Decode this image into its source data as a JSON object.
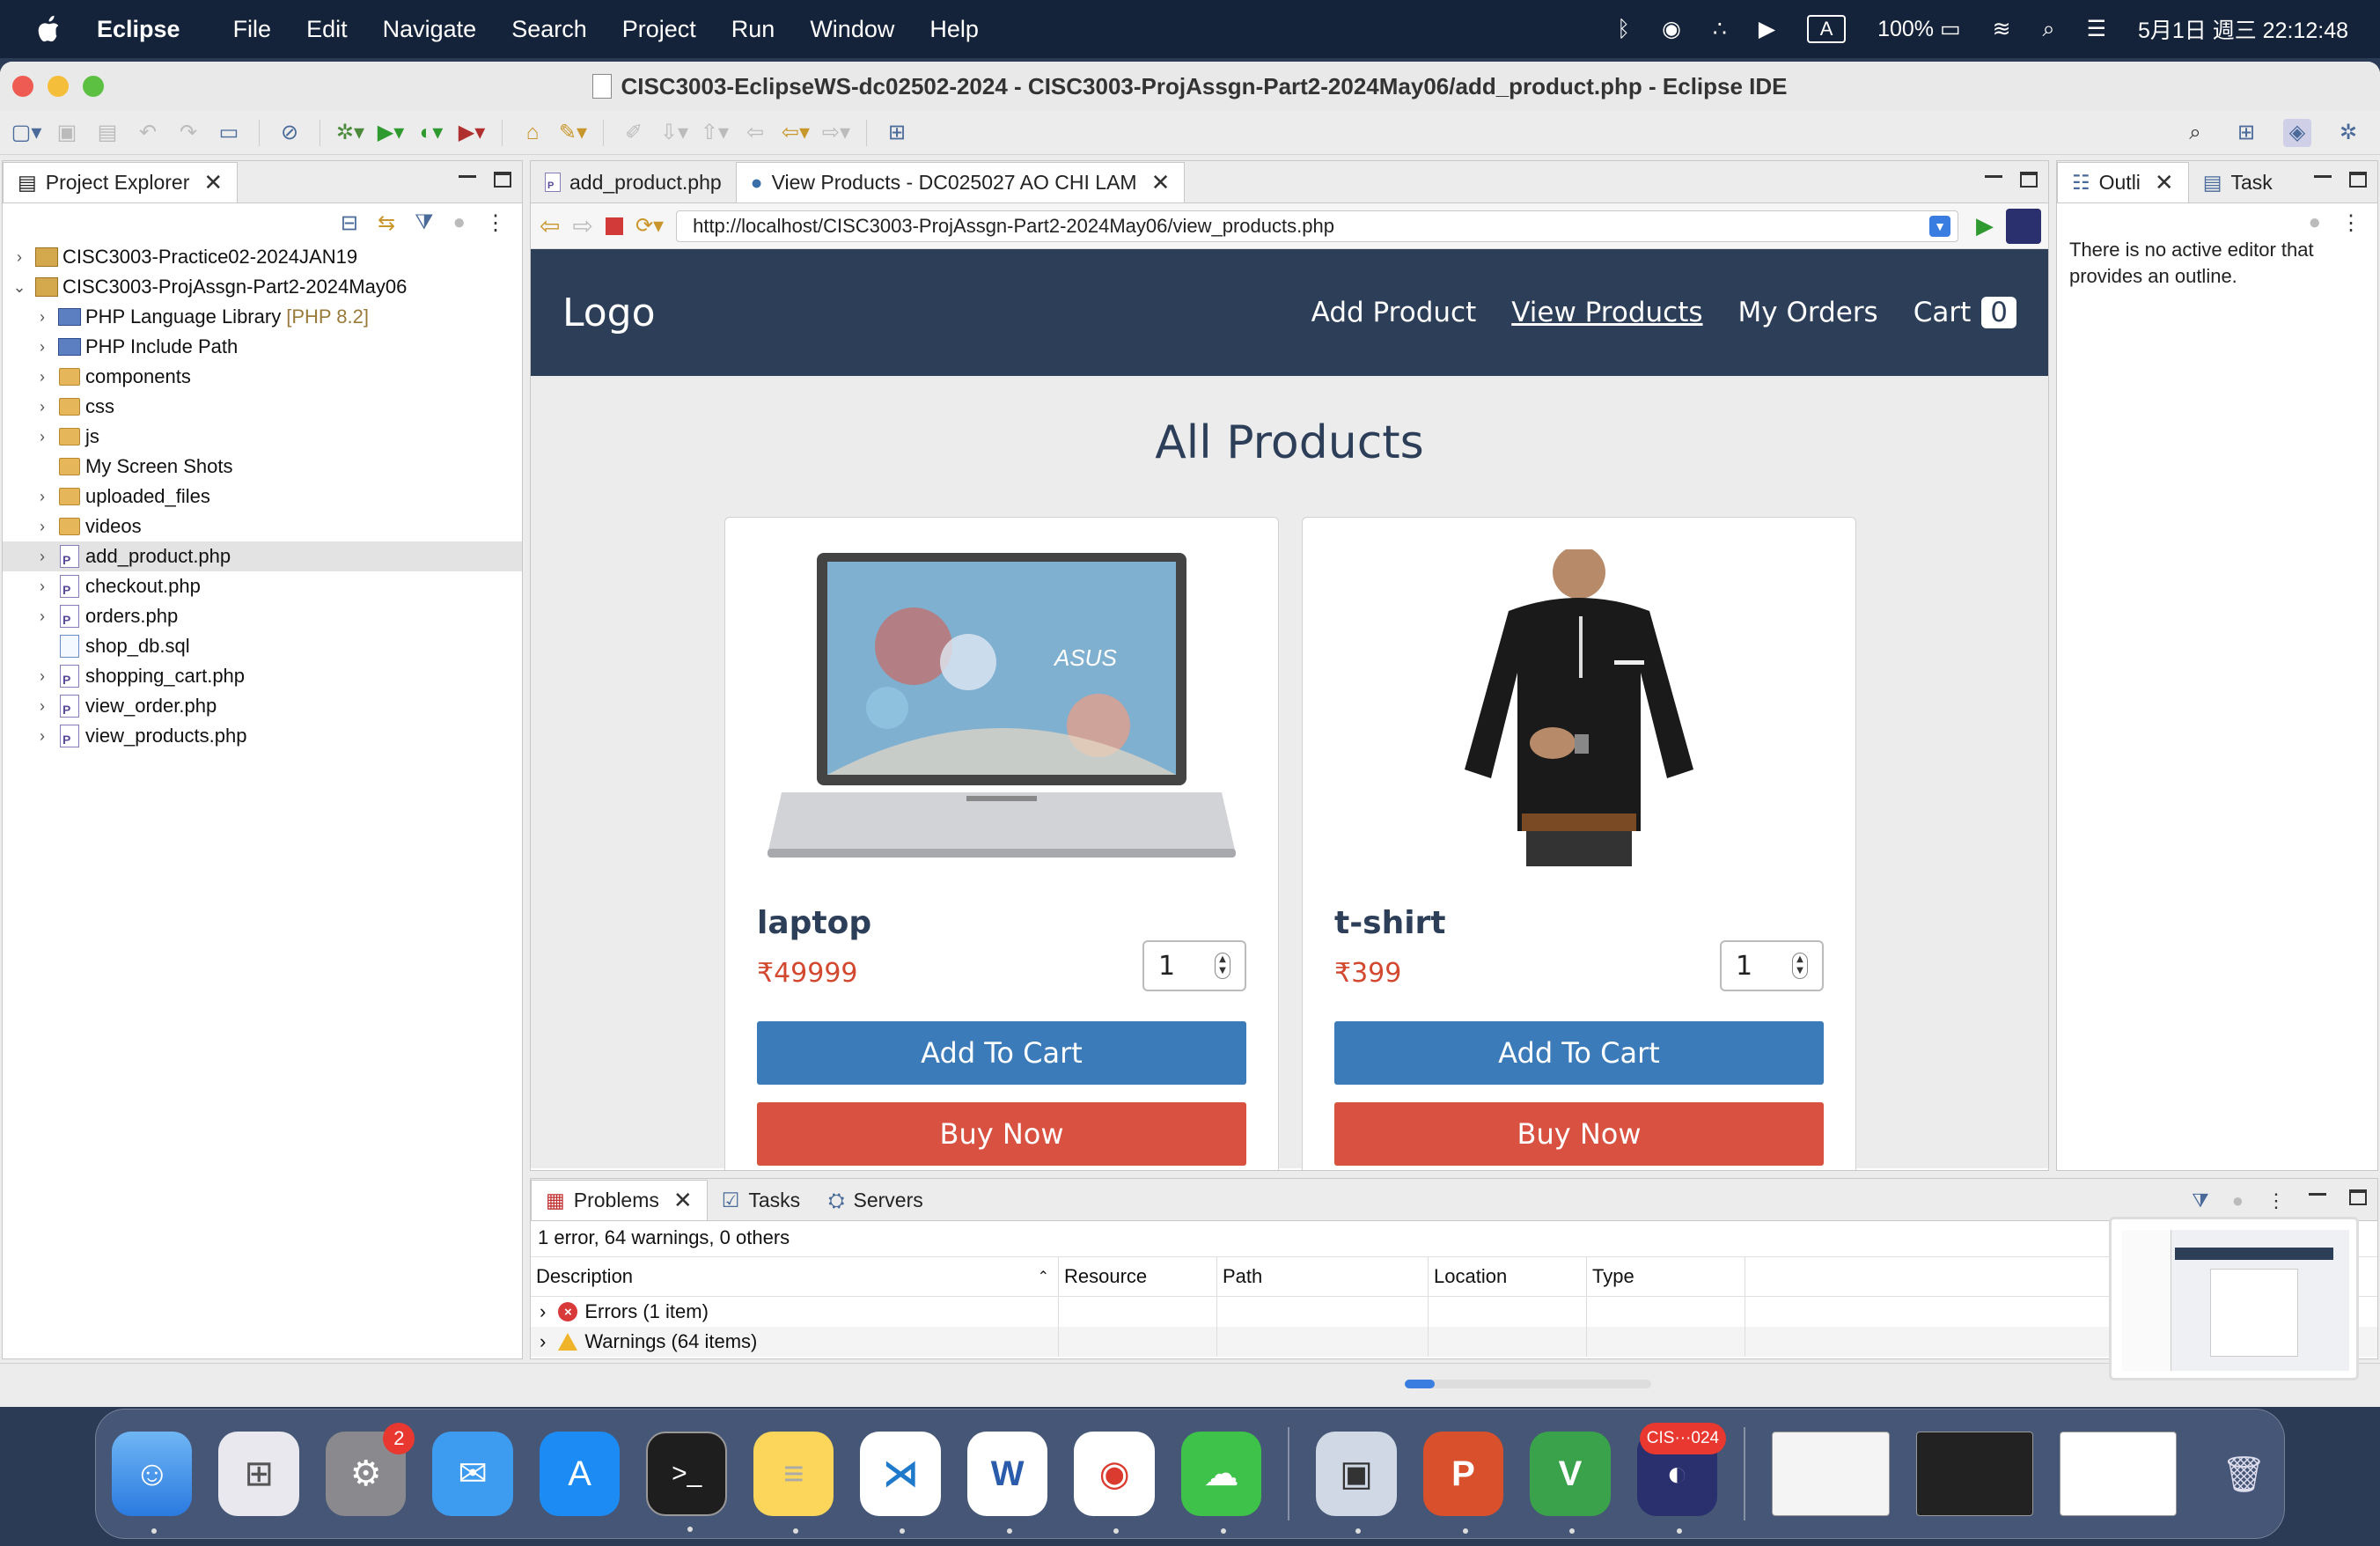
{
  "menubar": {
    "app": "Eclipse",
    "items": [
      "File",
      "Edit",
      "Navigate",
      "Search",
      "Project",
      "Run",
      "Window",
      "Help"
    ],
    "input_source": "A",
    "battery": "100%",
    "datetime": "5月1日 週三 22:12:48"
  },
  "window": {
    "title": "CISC3003-EclipseWS-dc02502-2024 - CISC3003-ProjAssgn-Part2-2024May06/add_product.php - Eclipse IDE"
  },
  "explorer": {
    "tab": "Project Explorer",
    "items": [
      {
        "label": "CISC3003-Practice02-2024JAN19",
        "suffix": "",
        "depth": 0,
        "expand": "›",
        "icon": "project-icon"
      },
      {
        "label": "CISC3003-ProjAssgn-Part2-2024May06",
        "suffix": "",
        "depth": 0,
        "expand": "⌄",
        "icon": "project-icon"
      },
      {
        "label": "PHP Language Library",
        "suffix": "[PHP 8.2]",
        "depth": 1,
        "expand": "›",
        "icon": "library-icon"
      },
      {
        "label": "PHP Include Path",
        "suffix": "",
        "depth": 1,
        "expand": "›",
        "icon": "library-icon"
      },
      {
        "label": "components",
        "suffix": "",
        "depth": 1,
        "expand": "›",
        "icon": "folder-icon"
      },
      {
        "label": "css",
        "suffix": "",
        "depth": 1,
        "expand": "›",
        "icon": "folder-icon"
      },
      {
        "label": "js",
        "suffix": "",
        "depth": 1,
        "expand": "›",
        "icon": "folder-icon"
      },
      {
        "label": "My Screen Shots",
        "suffix": "",
        "depth": 1,
        "expand": "",
        "icon": "folder-icon"
      },
      {
        "label": "uploaded_files",
        "suffix": "",
        "depth": 1,
        "expand": "›",
        "icon": "folder-icon"
      },
      {
        "label": "videos",
        "suffix": "",
        "depth": 1,
        "expand": "›",
        "icon": "folder-icon"
      },
      {
        "label": "add_product.php",
        "suffix": "",
        "depth": 1,
        "expand": "›",
        "icon": "php-file-icon"
      },
      {
        "label": "checkout.php",
        "suffix": "",
        "depth": 1,
        "expand": "›",
        "icon": "php-file-icon"
      },
      {
        "label": "orders.php",
        "suffix": "",
        "depth": 1,
        "expand": "›",
        "icon": "php-file-icon"
      },
      {
        "label": "shop_db.sql",
        "suffix": "",
        "depth": 1,
        "expand": "",
        "icon": "sql-file-icon"
      },
      {
        "label": "shopping_cart.php",
        "suffix": "",
        "depth": 1,
        "expand": "›",
        "icon": "php-file-icon"
      },
      {
        "label": "view_order.php",
        "suffix": "",
        "depth": 1,
        "expand": "›",
        "icon": "php-file-icon"
      },
      {
        "label": "view_products.php",
        "suffix": "",
        "depth": 1,
        "expand": "›",
        "icon": "php-file-icon"
      }
    ]
  },
  "editor": {
    "tabs": [
      "add_product.php",
      "View Products - DC025027 AO CHI LAM"
    ],
    "url": "http://localhost/CISC3003-ProjAssgn-Part2-2024May06/view_products.php"
  },
  "site": {
    "logo": "Logo",
    "nav": [
      "Add Product",
      "View Products",
      "My Orders",
      "Cart"
    ],
    "cart_count": "0",
    "heading": "All Products",
    "products": [
      {
        "name": "laptop",
        "price": "₹49999",
        "qty": "1",
        "add": "Add To Cart",
        "buy": "Buy Now"
      },
      {
        "name": "t-shirt",
        "price": "₹399",
        "qty": "1",
        "add": "Add To Cart",
        "buy": "Buy Now"
      }
    ]
  },
  "outline": {
    "tabs": [
      "Outli",
      "Task"
    ],
    "message": "There is no active editor that provides an outline."
  },
  "problems": {
    "tabs": [
      "Problems",
      "Tasks",
      "Servers"
    ],
    "summary": "1 error, 64 warnings, 0 others",
    "columns": [
      "Description",
      "Resource",
      "Path",
      "Location",
      "Type"
    ],
    "rows": [
      "Errors (1 item)",
      "Warnings (64 items)"
    ]
  },
  "dock": {
    "settings_badge": "2",
    "eclipse_badge": "CIS···024"
  },
  "colors": {
    "site_header": "#2c3e58",
    "add_to_cart": "#3c7bb9",
    "buy_now": "#d95140",
    "price": "#d2492f"
  }
}
